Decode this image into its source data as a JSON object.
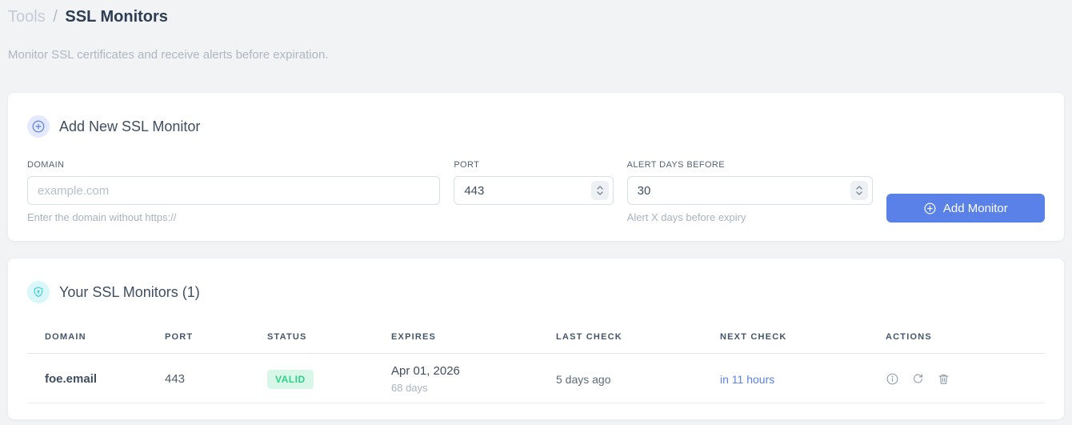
{
  "colors": {
    "accent_blue": "#5a81e8",
    "accent_cyan": "#38cfda",
    "success_text": "#2ed389",
    "success_bg": "#d9f7e9",
    "page_bg": "#f1f3f5"
  },
  "header": {
    "breadcrumb_parent": "Tools",
    "breadcrumb_separator": "/",
    "breadcrumb_current": "SSL Monitors",
    "subtitle": "Monitor SSL certificates and receive alerts before expiration."
  },
  "add_card": {
    "icon": "plus-circle-icon",
    "title": "Add New SSL Monitor",
    "domain_label": "DOMAIN",
    "domain_placeholder": "example.com",
    "domain_helper": "Enter the domain without https://",
    "port_label": "PORT",
    "port_value": "443",
    "alert_label": "ALERT DAYS BEFORE",
    "alert_value": "30",
    "alert_helper": "Alert X days before expiry",
    "submit_label": "Add Monitor"
  },
  "monitors_card": {
    "icon": "shield-icon",
    "title": "Your SSL Monitors (1)",
    "headers": [
      "DOMAIN",
      "PORT",
      "STATUS",
      "EXPIRES",
      "LAST CHECK",
      "NEXT CHECK",
      "ACTIONS"
    ],
    "rows": [
      {
        "domain": "foe.email",
        "port": "443",
        "status": "VALID",
        "expires_date": "Apr 01, 2026",
        "expires_remaining": "68 days",
        "last_check": "5 days ago",
        "next_check": "in 11 hours"
      }
    ]
  }
}
